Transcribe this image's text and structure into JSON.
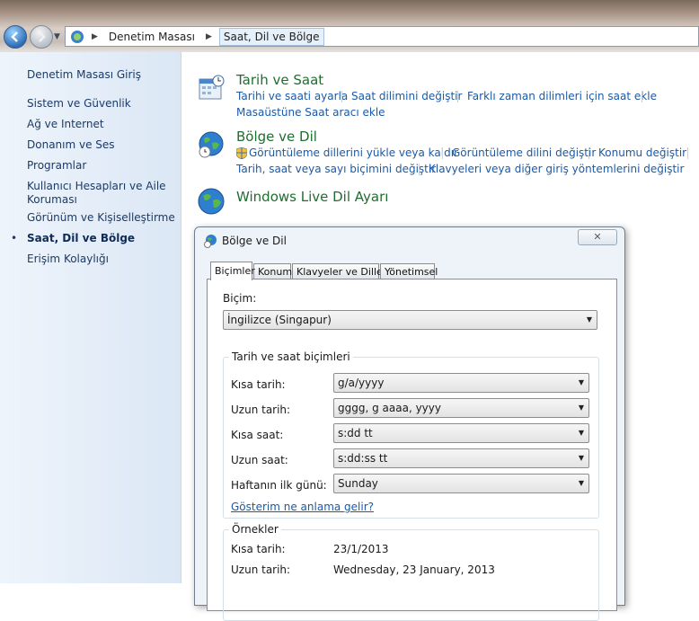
{
  "address_bar": {
    "crumbs": [
      "Denetim Masası",
      "Saat, Dil ve Bölge"
    ]
  },
  "left_panel": {
    "items": [
      {
        "label": "Denetim Masası Giriş"
      },
      {
        "label": "Sistem ve Güvenlik"
      },
      {
        "label": "Ağ ve Internet"
      },
      {
        "label": "Donanım ve Ses"
      },
      {
        "label": "Programlar"
      },
      {
        "label": "Kullanıcı Hesapları ve Aile\nKoruması"
      },
      {
        "label": "Görünüm ve Kişiselleştirme"
      },
      {
        "label": "Saat, Dil ve Bölge",
        "selected": true
      },
      {
        "label": "Erişim Kolaylığı"
      }
    ],
    "bullet": "•"
  },
  "sections": {
    "datetime": {
      "title": "Tarih ve Saat",
      "links": [
        "Tarihi ve saati ayarla",
        "Saat dilimini değiştir",
        "Farklı zaman dilimleri için saat ekle",
        "Masaüstüne Saat aracı ekle"
      ]
    },
    "region": {
      "title": "Bölge ve Dil",
      "links": [
        "Görüntüleme dillerini yükle veya kaldır",
        "Görüntüleme dilini değiştir",
        "Konumu değiştir",
        "Tarih, saat veya sayı biçimini değiştir",
        "Klavyeleri veya diğer giriş yöntemlerini değiştir"
      ]
    },
    "live": {
      "title": "Windows Live Dil Ayarı"
    }
  },
  "dialog": {
    "title": "Bölge ve Dil",
    "close": "✕",
    "tabs": [
      "Biçimler",
      "Konum",
      "Klavyeler ve Diller",
      "Yönetimsel"
    ],
    "format_label": "Biçim:",
    "format_value": "İngilizce (Singapur)",
    "group_title": "Tarih ve saat biçimleri",
    "fields": [
      {
        "label": "Kısa tarih:",
        "value": "g/a/yyyy"
      },
      {
        "label": "Uzun tarih:",
        "value": "gggg, g aaaa, yyyy"
      },
      {
        "label": "Kısa saat:",
        "value": "s:dd tt"
      },
      {
        "label": "Uzun saat:",
        "value": "s:dd:ss tt"
      },
      {
        "label": "Haftanın ilk günü:",
        "value": "Sunday"
      }
    ],
    "help_link": "Gösterim ne anlama gelir?",
    "examples_title": "Örnekler",
    "examples": [
      {
        "label": "Kısa tarih:",
        "value": "23/1/2013"
      },
      {
        "label": "Uzun tarih:",
        "value": "Wednesday, 23 January, 2013"
      }
    ]
  },
  "colors": {
    "link": "#1a5aa8",
    "section_title": "#1f6e2f",
    "left_panel": "#dbe7f5"
  }
}
